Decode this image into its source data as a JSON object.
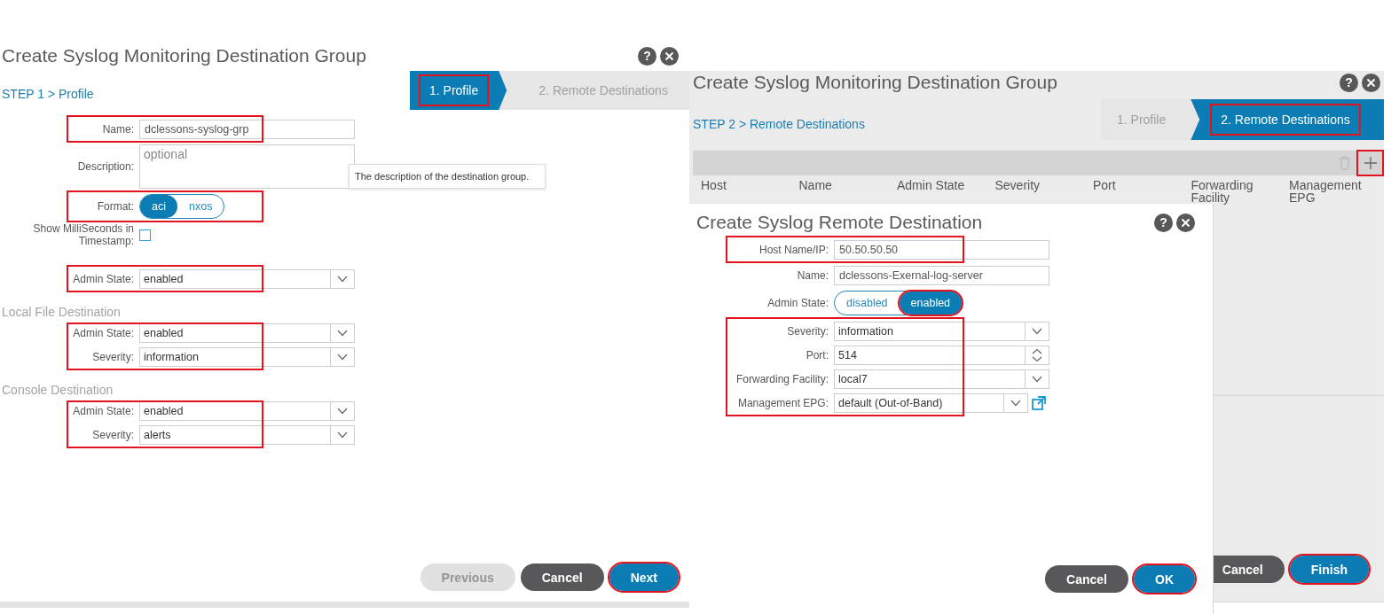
{
  "profile_dialog": {
    "title": "Create Syslog Monitoring Destination Group",
    "help": "?",
    "step_heading": "STEP 1 > Profile",
    "steps": [
      {
        "label": "1. Profile",
        "selected": true,
        "highlighted": true
      },
      {
        "label": "2. Remote Destinations",
        "selected": false,
        "highlighted": false
      }
    ],
    "groups": [
      {
        "highlighted": true,
        "fields": [
          {
            "kind": "text",
            "label": "Name:",
            "value": "dclessons-syslog-grp"
          }
        ]
      },
      {
        "highlighted": false,
        "fields": [
          {
            "kind": "textarea",
            "label": "Description:",
            "placeholder": "optional"
          }
        ]
      },
      {
        "highlighted": true,
        "fields": [
          {
            "kind": "toggle",
            "label": "Format:",
            "options": [
              {
                "label": "aci",
                "selected": true,
                "highlighted": false
              },
              {
                "label": "nxos",
                "selected": false,
                "highlighted": false
              }
            ]
          }
        ]
      },
      {
        "highlighted": false,
        "fields": [
          {
            "kind": "checkbox",
            "label": "Show MilliSeconds in Timestamp:",
            "checked": false
          }
        ]
      },
      {
        "highlighted": true,
        "fields": [
          {
            "kind": "select",
            "label": "Admin State:",
            "value": "enabled"
          }
        ]
      },
      {
        "heading": "Local File Destination",
        "highlighted": true,
        "fields": [
          {
            "kind": "select",
            "label": "Admin State:",
            "value": "enabled"
          },
          {
            "kind": "select",
            "label": "Severity:",
            "value": "information"
          }
        ]
      },
      {
        "heading": "Console Destination",
        "highlighted": true,
        "fields": [
          {
            "kind": "select",
            "label": "Admin State:",
            "value": "enabled"
          },
          {
            "kind": "select",
            "label": "Severity:",
            "value": "alerts"
          }
        ]
      }
    ],
    "tooltip": "The description of the destination group.",
    "buttons": [
      {
        "label": "Previous",
        "kind": "secondary",
        "disabled": true,
        "highlighted": false
      },
      {
        "label": "Cancel",
        "kind": "secondary",
        "disabled": false,
        "highlighted": false
      },
      {
        "label": "Next",
        "kind": "primary",
        "disabled": false,
        "highlighted": true
      }
    ]
  },
  "remote_dialog": {
    "title": "Create Syslog Monitoring Destination Group",
    "help": "?",
    "step_heading": "STEP 2 > Remote Destinations",
    "steps": [
      {
        "label": "1. Profile",
        "selected": false,
        "highlighted": false
      },
      {
        "label": "2. Remote Destinations",
        "selected": true,
        "highlighted": true
      }
    ],
    "add_button": {
      "highlighted": true
    },
    "columns": [
      "Host",
      "Name",
      "Admin State",
      "Severity",
      "Port",
      "Forwarding Facility",
      "Management EPG"
    ],
    "buttons": [
      {
        "label": "Cancel",
        "kind": "secondary",
        "disabled": false,
        "highlighted": false
      },
      {
        "label": "Finish",
        "kind": "primary",
        "disabled": false,
        "highlighted": true
      }
    ]
  },
  "destination_dialog": {
    "title": "Create Syslog Remote Destination",
    "help": "?",
    "groups": [
      {
        "highlighted": true,
        "fields": [
          {
            "kind": "text",
            "label": "Host Name/IP:",
            "value": "50.50.50.50"
          }
        ]
      },
      {
        "highlighted": false,
        "fields": [
          {
            "kind": "text",
            "label": "Name:",
            "value": "dclessons-Exernal-log-server"
          }
        ]
      },
      {
        "highlighted": false,
        "fields": [
          {
            "kind": "toggle",
            "label": "Admin State:",
            "options": [
              {
                "label": "disabled",
                "selected": false,
                "highlighted": false
              },
              {
                "label": "enabled",
                "selected": true,
                "highlighted": true
              }
            ]
          }
        ]
      },
      {
        "highlighted": true,
        "fields": [
          {
            "kind": "select",
            "label": "Severity:",
            "value": "information"
          },
          {
            "kind": "spinner",
            "label": "Port:",
            "value": "514"
          },
          {
            "kind": "select",
            "label": "Forwarding Facility:",
            "value": "local7"
          },
          {
            "kind": "select-link",
            "label": "Management EPG:",
            "value": "default (Out-of-Band)"
          }
        ]
      }
    ],
    "buttons": [
      {
        "label": "Cancel",
        "kind": "secondary",
        "disabled": false,
        "highlighted": false
      },
      {
        "label": "OK",
        "kind": "primary",
        "disabled": false,
        "highlighted": true
      }
    ]
  }
}
